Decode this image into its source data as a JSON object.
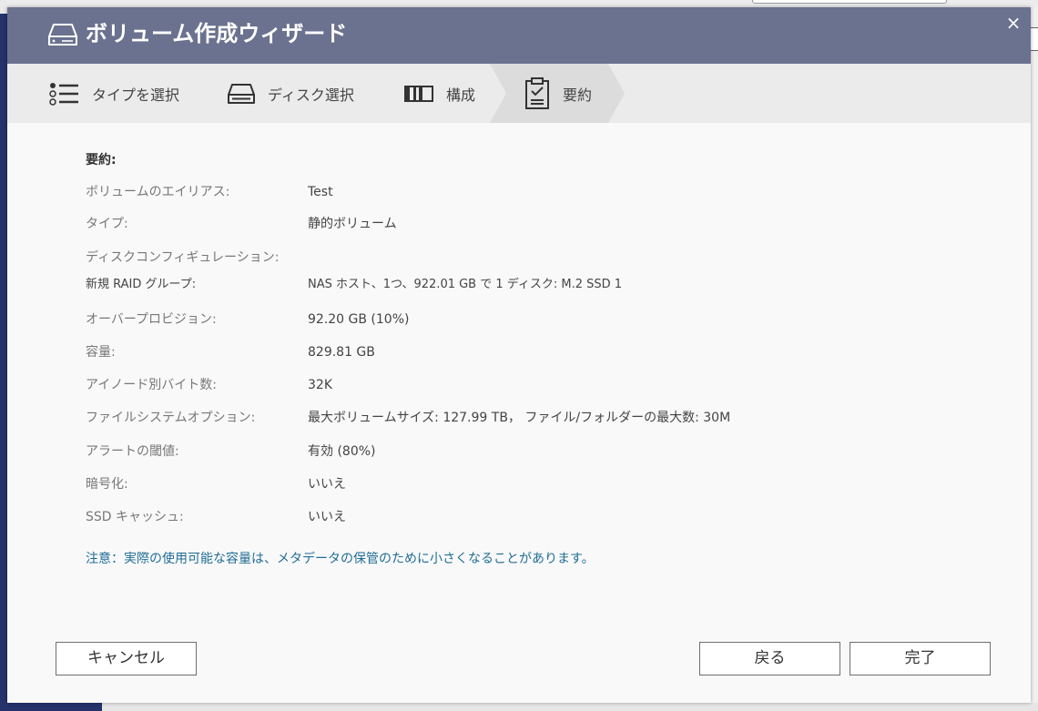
{
  "dialog": {
    "title": "ボリューム作成ウィザード",
    "close_label": "×",
    "title_icon": "disk-drive-icon"
  },
  "steps": [
    {
      "label": "タイプを選択",
      "icon": "list-icon",
      "active": false
    },
    {
      "label": "ディスク選択",
      "icon": "disk-icon",
      "active": false
    },
    {
      "label": "構成",
      "icon": "configure-icon",
      "active": false
    },
    {
      "label": "要約",
      "icon": "clipboard-icon",
      "active": true
    }
  ],
  "summary": {
    "heading": "要約:",
    "rows": [
      {
        "key": "ボリュームのエイリアス:",
        "value": "Test"
      },
      {
        "key": "タイプ:",
        "value": "静的ボリューム"
      },
      {
        "key": "ディスクコンフィギュレーション:",
        "value": ""
      },
      {
        "key": "新規 RAID グループ:",
        "value": "NAS ホスト、1つ、922.01 GB で 1 ディスク: M.2 SSD 1"
      },
      {
        "key": "オーバープロビジョン:",
        "value": "92.20 GB (10%)"
      },
      {
        "key": "容量:",
        "value": "829.81 GB"
      },
      {
        "key": "アイノード別バイト数:",
        "value": "32K"
      },
      {
        "key": "ファイルシステムオプション:",
        "value": "最大ボリュームサイズ: 127.99 TB， ファイル/フォルダーの最大数: 30M"
      },
      {
        "key": "アラートの閾値:",
        "value": "有効 (80%)"
      },
      {
        "key": "暗号化:",
        "value": "いいえ"
      },
      {
        "key": "SSD キャッシュ:",
        "value": "いいえ"
      }
    ],
    "note": "注意：実際の使用可能な容量は、メタデータの保管のために小さくなることがあります。"
  },
  "buttons": {
    "cancel": "キャンセル",
    "back": "戻る",
    "finish": "完了"
  },
  "colors": {
    "titlebar": "#6b728f",
    "stepbar": "#ebebeb",
    "active_step": "#dcdcdc",
    "note_text": "#1f6d95"
  }
}
